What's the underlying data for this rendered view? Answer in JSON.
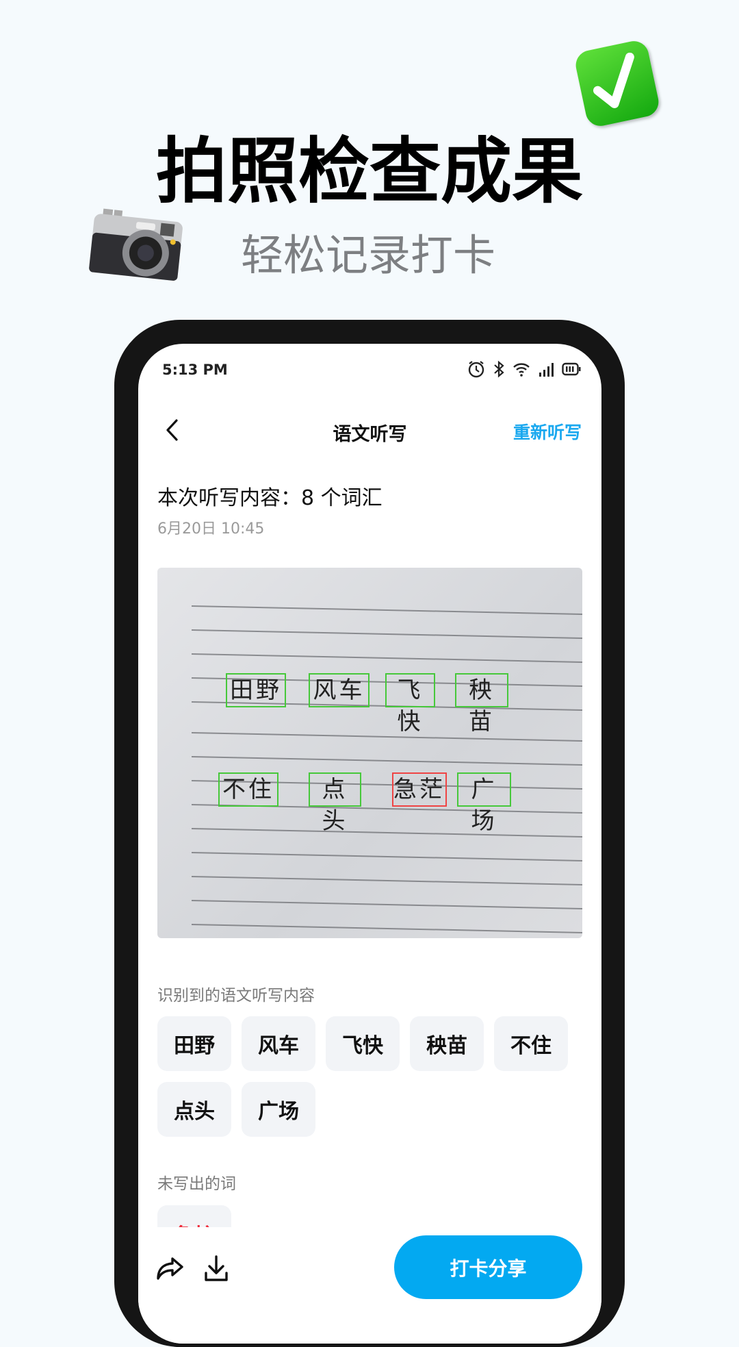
{
  "hero": {
    "title": "拍照检查成果",
    "subtitle": "轻松记录打卡",
    "icons": [
      "check-mark-icon",
      "camera-icon"
    ]
  },
  "status_bar": {
    "time": "5:13 PM",
    "icons": [
      "alarm-icon",
      "bluetooth-icon",
      "wifi-icon",
      "signal-icon",
      "battery-icon"
    ]
  },
  "nav": {
    "title": "语文听写",
    "redo_label": "重新听写"
  },
  "summary": {
    "text": "本次听写内容：8 个词汇",
    "date": "6月20日 10:45"
  },
  "photo": {
    "row1": [
      {
        "text": "田野",
        "ok": true
      },
      {
        "text": "风车",
        "ok": true
      },
      {
        "text": "飞快",
        "ok": true
      },
      {
        "text": "秧苗",
        "ok": true
      }
    ],
    "row2": [
      {
        "text": "不住",
        "ok": true
      },
      {
        "text": "点头",
        "ok": true
      },
      {
        "text": "急茫",
        "ok": false
      },
      {
        "text": "广场",
        "ok": true
      }
    ]
  },
  "recognized": {
    "label": "识别到的语文听写内容",
    "words": [
      "田野",
      "风车",
      "飞快",
      "秧苗",
      "不住",
      "点头",
      "广场"
    ]
  },
  "missing": {
    "label": "未写出的词",
    "words": [
      "急忙"
    ]
  },
  "bottom": {
    "share_button": "打卡分享"
  },
  "colors": {
    "accent": "#03a9f1",
    "correct_box": "#46c83a",
    "wrong_box": "#ef4444",
    "missing_text": "#ef2a3a"
  }
}
